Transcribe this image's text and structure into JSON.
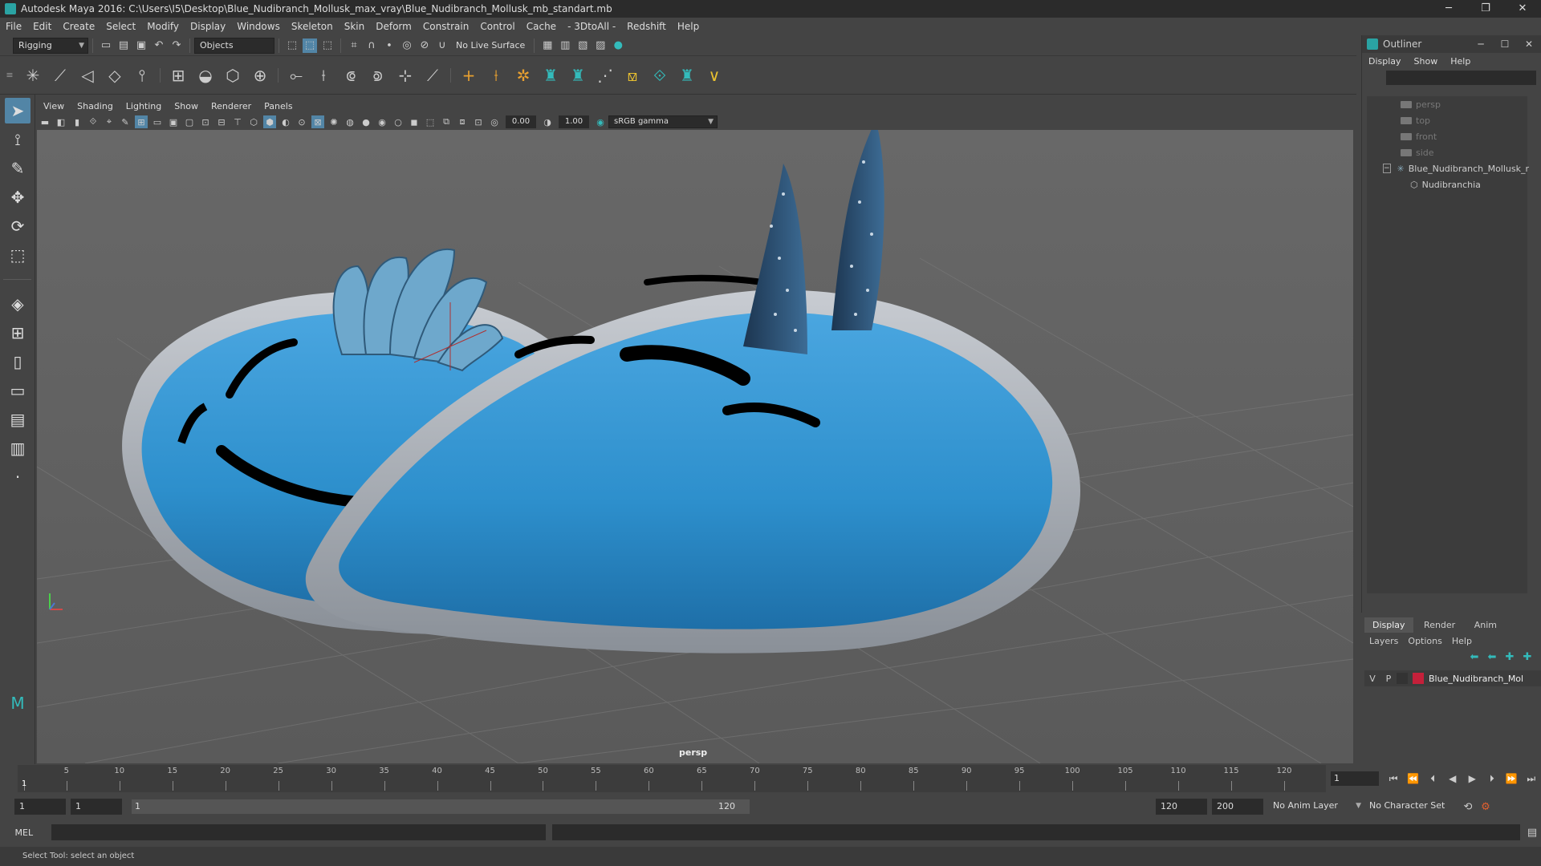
{
  "window": {
    "title": "Autodesk Maya 2016: C:\\Users\\I5\\Desktop\\Blue_Nudibranch_Mollusk_max_vray\\Blue_Nudibranch_Mollusk_mb_standart.mb",
    "minimize": "─",
    "restore": "❐",
    "close": "✕"
  },
  "menubar": [
    "File",
    "Edit",
    "Create",
    "Select",
    "Modify",
    "Display",
    "Windows",
    "Skeleton",
    "Skin",
    "Deform",
    "Constrain",
    "Control",
    "Cache",
    "- 3DtoAll -",
    "Redshift",
    "Help"
  ],
  "statusline": {
    "mode": "Rigging",
    "selection_mode": "Objects",
    "live_surface": "No Live Surface"
  },
  "panel": {
    "menu": [
      "View",
      "Shading",
      "Lighting",
      "Show",
      "Renderer",
      "Panels"
    ],
    "exposure": "0.00",
    "gamma": "1.00",
    "color_space": "sRGB gamma",
    "camera": "persp"
  },
  "outliner": {
    "title": "Outliner",
    "menu": [
      "Display",
      "Show",
      "Help"
    ],
    "items": [
      {
        "label": "persp",
        "dim": true
      },
      {
        "label": "top",
        "dim": true
      },
      {
        "label": "front",
        "dim": true
      },
      {
        "label": "side",
        "dim": true
      },
      {
        "label": "Blue_Nudibranch_Mollusk_r",
        "dim": false
      },
      {
        "label": "Nudibranchia",
        "dim": false
      }
    ]
  },
  "layers": {
    "tabs": [
      "Display",
      "Render",
      "Anim"
    ],
    "active_tab": "Display",
    "menu": [
      "Layers",
      "Options",
      "Help"
    ],
    "row": {
      "v": "V",
      "p": "P",
      "name": "Blue_Nudibranch_Mol",
      "color": "#c4203a"
    }
  },
  "timeline": {
    "ticks": [
      1,
      5,
      10,
      15,
      20,
      25,
      30,
      35,
      40,
      45,
      50,
      55,
      60,
      65,
      70,
      75,
      80,
      85,
      90,
      95,
      100,
      105,
      110,
      115,
      120
    ],
    "current_frame": "1"
  },
  "range": {
    "start": "1",
    "anim_start": "1",
    "range_start": "1",
    "range_end": "120",
    "anim_end": "120",
    "end": "200",
    "anim_layer": "No Anim Layer",
    "character_set": "No Character Set"
  },
  "cmdline": {
    "label": "MEL"
  },
  "helpline": {
    "text": "Select Tool: select an object"
  }
}
